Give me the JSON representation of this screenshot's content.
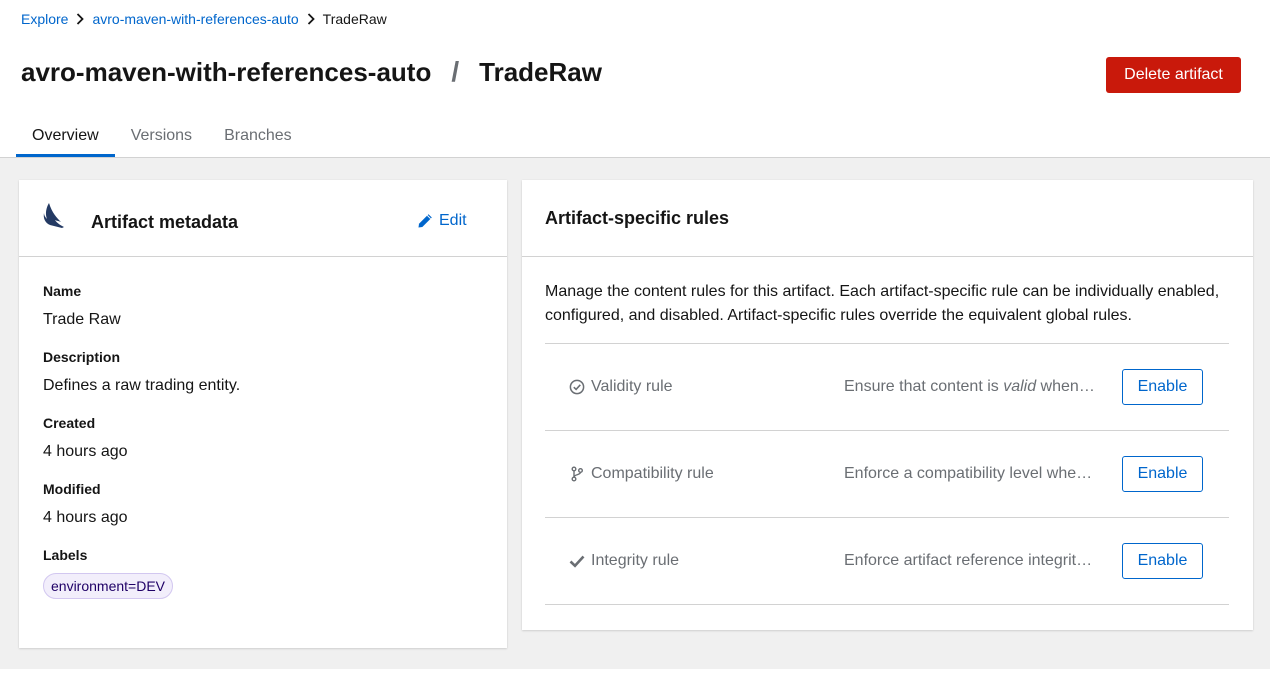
{
  "breadcrumb": {
    "items": [
      "Explore",
      "avro-maven-with-references-auto"
    ],
    "current": "TradeRaw"
  },
  "title": {
    "group": "avro-maven-with-references-auto",
    "separator": "/",
    "artifact": "TradeRaw"
  },
  "actions": {
    "delete_label": "Delete artifact"
  },
  "tabs": [
    {
      "label": "Overview",
      "active": true
    },
    {
      "label": "Versions",
      "active": false
    },
    {
      "label": "Branches",
      "active": false
    }
  ],
  "metadata_card": {
    "title": "Artifact metadata",
    "edit_label": "Edit",
    "fields": {
      "name": {
        "term": "Name",
        "value": "Trade Raw"
      },
      "description": {
        "term": "Description",
        "value": "Defines a raw trading entity."
      },
      "created": {
        "term": "Created",
        "value": "4 hours ago"
      },
      "modified": {
        "term": "Modified",
        "value": "4 hours ago"
      },
      "labels": {
        "term": "Labels",
        "value": "environment=DEV"
      }
    }
  },
  "rules_card": {
    "title": "Artifact-specific rules",
    "intro": "Manage the content rules for this artifact. Each artifact-specific rule can be individually enabled, configured, and disabled. Artifact-specific rules override the equivalent global rules.",
    "rules": [
      {
        "name": "Validity rule",
        "desc_before": "Ensure that content is ",
        "desc_em": "valid",
        "desc_after": " when updating this artifact.",
        "button": "Enable",
        "icon": "check-circle-icon"
      },
      {
        "name": "Compatibility rule",
        "desc_before": "Enforce a compatibility level when updating this artifact.",
        "desc_em": "",
        "desc_after": "",
        "button": "Enable",
        "icon": "code-branch-icon"
      },
      {
        "name": "Integrity rule",
        "desc_before": "Enforce artifact reference integrity when creating or updating artifacts.",
        "desc_em": "",
        "desc_after": "",
        "button": "Enable",
        "icon": "check-icon"
      }
    ]
  },
  "colors": {
    "primary": "#0066cc",
    "danger": "#c9190b",
    "background": "#f0f0f0",
    "label_chip": "#f2eefb"
  }
}
